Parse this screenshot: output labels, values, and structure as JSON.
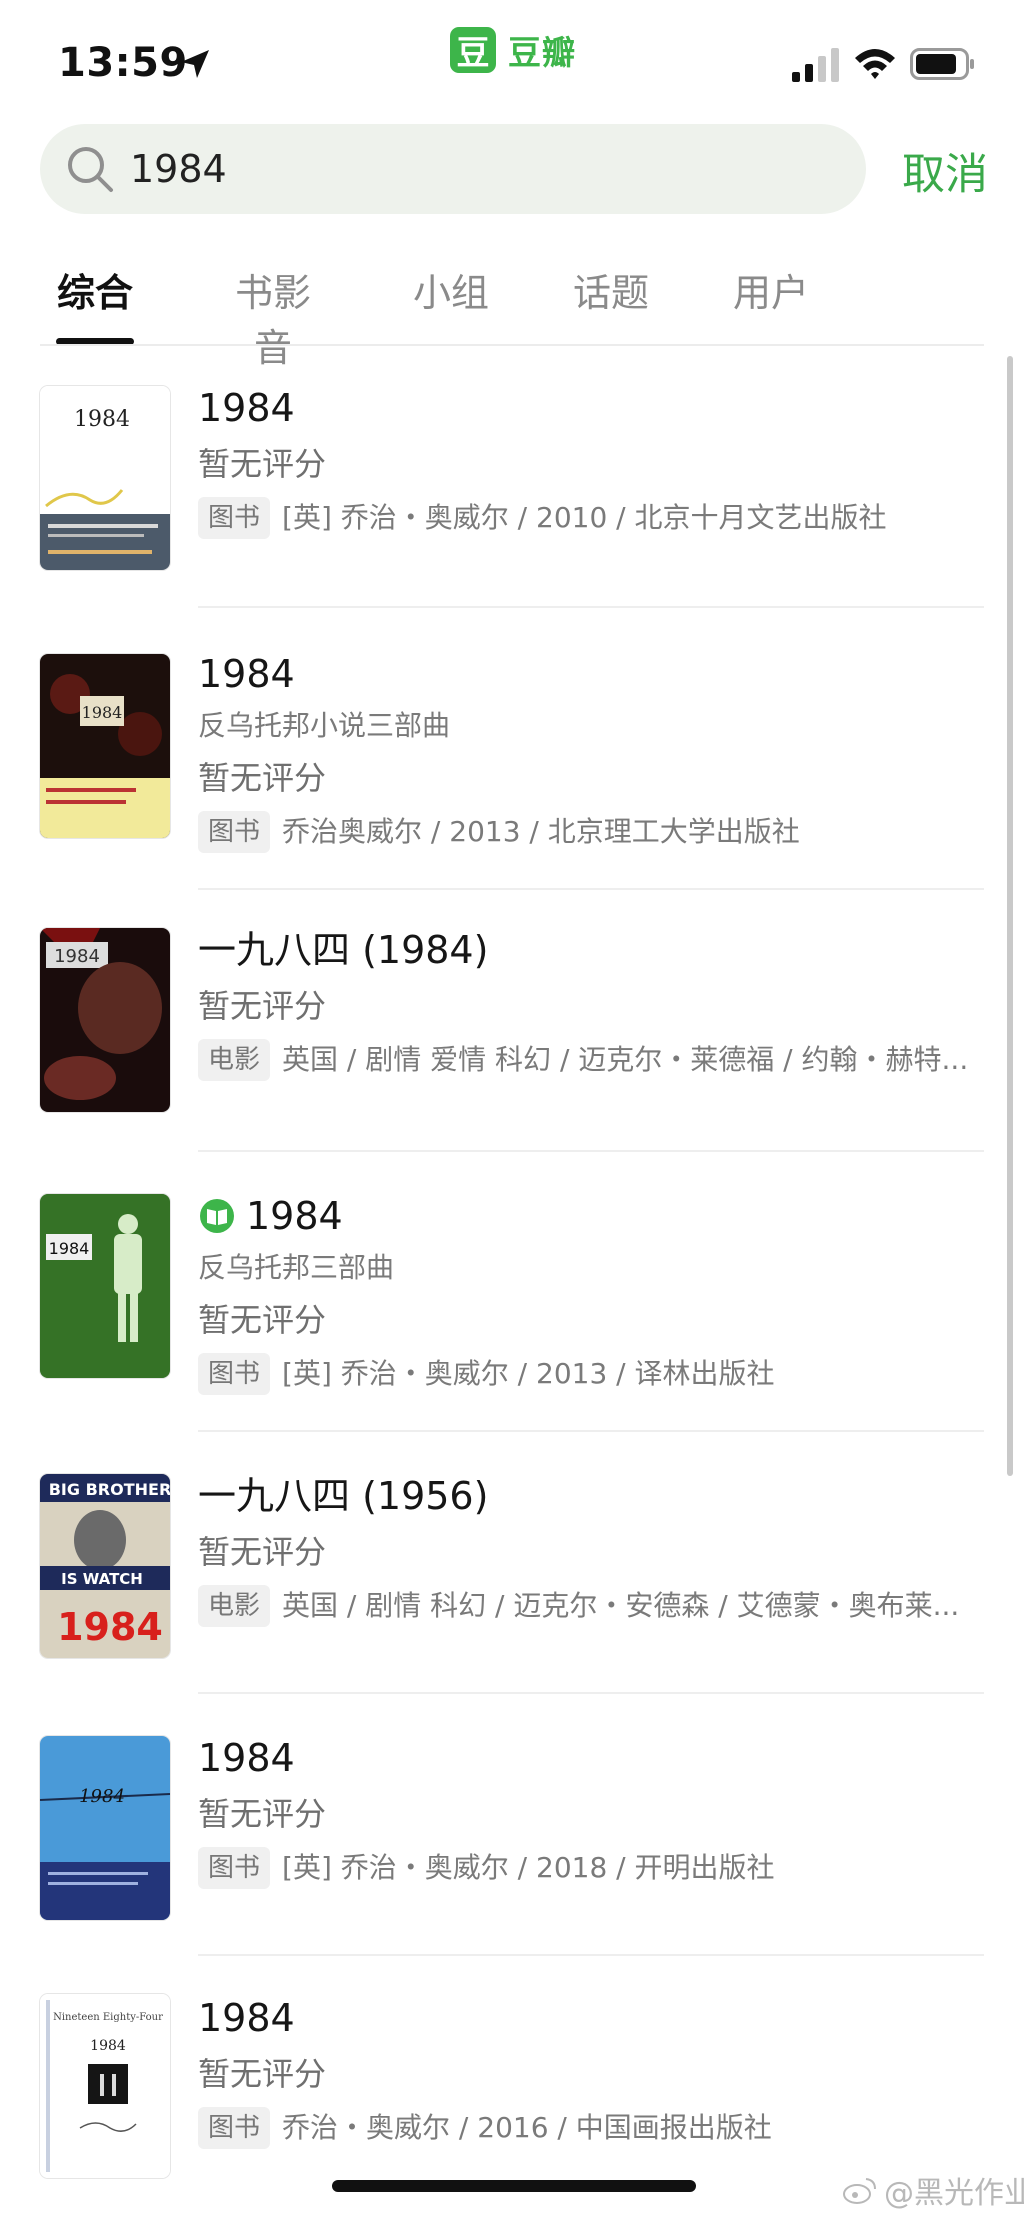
{
  "status_bar": {
    "time": "13:59",
    "app_name": "豆瓣",
    "app_badge": "豆"
  },
  "search": {
    "value": "1984",
    "placeholder": "",
    "cancel_label": "取消"
  },
  "tabs": [
    {
      "label": "综合",
      "active": true
    },
    {
      "label": "书影音",
      "active": false
    },
    {
      "label": "小组",
      "active": false
    },
    {
      "label": "话题",
      "active": false
    },
    {
      "label": "用户",
      "active": false
    }
  ],
  "results": [
    {
      "title": "1984",
      "rating": "暂无评分",
      "type": "图书",
      "meta": "[英] 乔治・奥威尔 / 2010 / 北京十月文艺出版社",
      "cover_title": "1984"
    },
    {
      "title": "1984",
      "subtitle": "反乌托邦小说三部曲",
      "rating": "暂无评分",
      "type": "图书",
      "meta": "乔治奥威尔 / 2013 / 北京理工大学出版社",
      "cover_title": "1984"
    },
    {
      "title": "一九八四 (1984)",
      "rating": "暂无评分",
      "type": "电影",
      "meta": "英国 / 剧情 爱情 科幻 / 迈克尔・莱德福 / 约翰・赫特...",
      "cover_title": "1984"
    },
    {
      "title": "1984",
      "subtitle": "反乌托邦三部曲",
      "rating": "暂无评分",
      "type": "图书",
      "meta": "[英] 乔治・奥威尔 / 2013 / 译林出版社",
      "cover_title": "1984",
      "has_read_icon": true
    },
    {
      "title": "一九八四 (1956)",
      "rating": "暂无评分",
      "type": "电影",
      "meta": "英国 / 剧情 科幻 / 迈克尔・安德森 / 艾德蒙・奥布莱...",
      "cover_title": "1984",
      "cover_text_top": "BIG BROTHER",
      "cover_text_mid": "IS WATCH"
    },
    {
      "title": "1984",
      "rating": "暂无评分",
      "type": "图书",
      "meta": "[英] 乔治・奥威尔 / 2018 / 开明出版社",
      "cover_title": "1984"
    },
    {
      "title": "1984",
      "rating": "暂无评分",
      "type": "图书",
      "meta": "乔治・奥威尔 / 2016 / 中国画报出版社",
      "cover_title": "1984",
      "cover_subtitle": "Nineteen Eighty-Four"
    }
  ],
  "watermark": "@黑光作业",
  "colors": {
    "accent_green": "#3db54a",
    "search_bg": "#eef2ec",
    "muted_text": "#7a7a7a"
  },
  "icons": [
    "location-icon",
    "signal-icon",
    "wifi-icon",
    "battery-icon",
    "search-icon",
    "read-icon",
    "weibo-icon"
  ]
}
